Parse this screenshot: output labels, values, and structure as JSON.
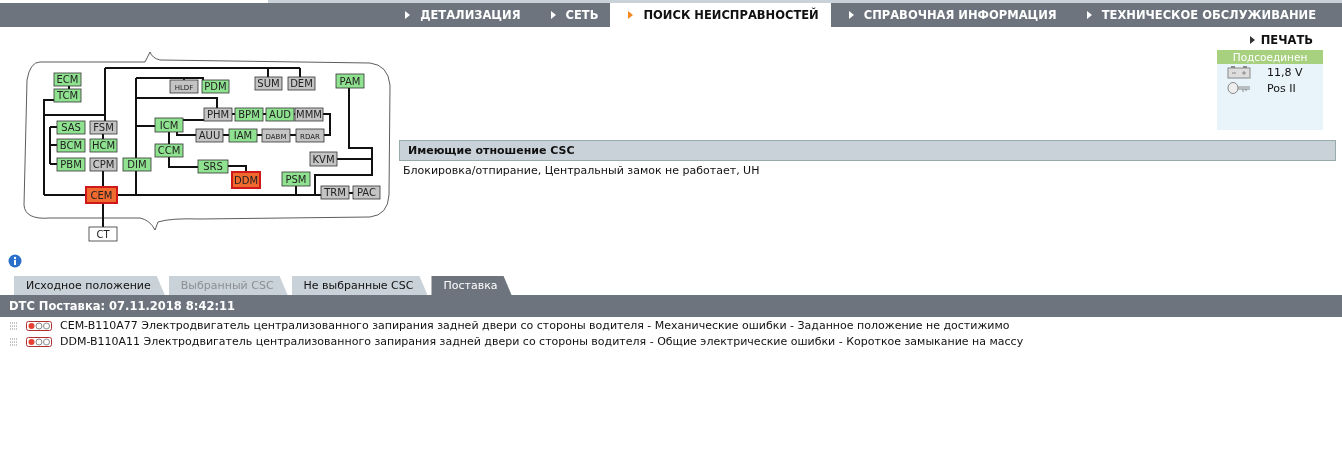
{
  "nav_tabs": [
    {
      "label": "ДЕТАЛИЗАЦИЯ",
      "selected": false
    },
    {
      "label": "СЕТЬ",
      "selected": false
    },
    {
      "label": "ПОИСК НЕИСПРАВНОСТЕЙ",
      "selected": true
    },
    {
      "label": "СПРАВОЧНАЯ ИНФОРМАЦИЯ",
      "selected": false
    },
    {
      "label": "ТЕХНИЧЕСКОЕ ОБСЛУЖИВАНИЕ",
      "selected": false
    }
  ],
  "print_link": "ПЕЧАТЬ",
  "status": {
    "connection": "Подсоединен",
    "voltage": "11,8 V",
    "key_position": "Pos II"
  },
  "network_nodes": [
    {
      "name": "ECM",
      "color": "#8fe28f",
      "fault": false
    },
    {
      "name": "TCM",
      "color": "#8fe28f",
      "fault": false
    },
    {
      "name": "SAS",
      "color": "#8fe28f",
      "fault": false
    },
    {
      "name": "FSM",
      "color": "#c4c4c4",
      "fault": false
    },
    {
      "name": "BCM",
      "color": "#8fe28f",
      "fault": false
    },
    {
      "name": "HCM",
      "color": "#8fe28f",
      "fault": false
    },
    {
      "name": "PBM",
      "color": "#8fe28f",
      "fault": false
    },
    {
      "name": "CPM",
      "color": "#c4c4c4",
      "fault": false
    },
    {
      "name": "DIM",
      "color": "#8fe28f",
      "fault": false
    },
    {
      "name": "CEM",
      "color": "#f06a30",
      "fault": true
    },
    {
      "name": "CT",
      "fault": false
    },
    {
      "name": "HLDF",
      "color": "#c4c4c4",
      "fault": false
    },
    {
      "name": "PDM",
      "color": "#8fe28f",
      "fault": false
    },
    {
      "name": "SUM",
      "color": "#c4c4c4",
      "fault": false
    },
    {
      "name": "DEM",
      "color": "#c4c4c4",
      "fault": false
    },
    {
      "name": "PAM",
      "color": "#8fe28f",
      "fault": false
    },
    {
      "name": "PHM",
      "color": "#c4c4c4",
      "fault": false
    },
    {
      "name": "BPM",
      "color": "#8fe28f",
      "fault": false
    },
    {
      "name": "AUD",
      "color": "#8fe28f",
      "fault": false
    },
    {
      "name": "MMM",
      "color": "#c4c4c4",
      "fault": false
    },
    {
      "name": "ICM",
      "color": "#8fe28f",
      "fault": false
    },
    {
      "name": "AUU",
      "color": "#c4c4c4",
      "fault": false
    },
    {
      "name": "IAM",
      "color": "#8fe28f",
      "fault": false
    },
    {
      "name": "DABM",
      "color": "#c4c4c4",
      "fault": false
    },
    {
      "name": "RDAR",
      "color": "#c4c4c4",
      "fault": false
    },
    {
      "name": "CCM",
      "color": "#8fe28f",
      "fault": false
    },
    {
      "name": "SRS",
      "color": "#8fe28f",
      "fault": false
    },
    {
      "name": "DDM",
      "color": "#f06a30",
      "fault": true
    },
    {
      "name": "KVM",
      "color": "#c4c4c4",
      "fault": false
    },
    {
      "name": "PSM",
      "color": "#8fe28f",
      "fault": false
    },
    {
      "name": "TRM",
      "color": "#c4c4c4",
      "fault": false
    },
    {
      "name": "PAC",
      "color": "#c4c4c4",
      "fault": false
    }
  ],
  "related_csc": {
    "title": "Имеющие отношение CSC",
    "text": "Блокировка/отпирание, Центральный замок не работает, UH"
  },
  "sub_tabs": [
    {
      "label": "Исходное положение",
      "selected": false,
      "disabled": false
    },
    {
      "label": "Выбранный CSC",
      "selected": false,
      "disabled": true
    },
    {
      "label": "Не выбранные CSC",
      "selected": false,
      "disabled": false
    },
    {
      "label": "Поставка",
      "selected": true,
      "disabled": false
    }
  ],
  "dtc": {
    "title": "DTC Поставка: 07.11.2018 8:42:11",
    "rows": [
      {
        "text": "CEM-B110A77 Электродвигатель централизованного запирания задней двери со стороны водителя - Механические ошибки - Заданное положение не достижимо"
      },
      {
        "text": "DDM-B110A11 Электродвигатель централизованного запирания задней двери со стороны водителя - Общие электрические ошибки - Короткое замыкание на массу"
      }
    ]
  }
}
